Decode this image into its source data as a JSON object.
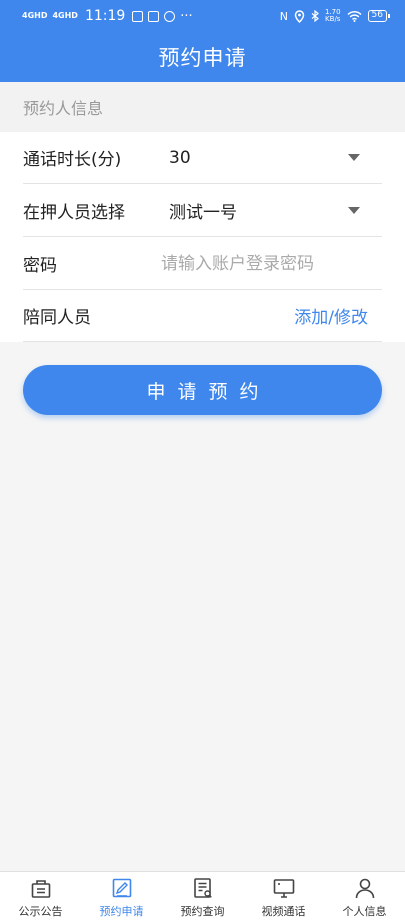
{
  "status_bar": {
    "network1": "4GHD",
    "network2": "4GHD",
    "time": "11:19",
    "more": "···",
    "nfc": "N",
    "speed_value": "1.70",
    "speed_unit": "KB/s",
    "battery": "56"
  },
  "header": {
    "title": "预约申请"
  },
  "section": {
    "title": "预约人信息"
  },
  "form": {
    "duration": {
      "label": "通话时长(分)",
      "value": "30"
    },
    "detainee": {
      "label": "在押人员选择",
      "value": "测试一号"
    },
    "password": {
      "label": "密码",
      "placeholder": "请输入账户登录密码"
    },
    "companion": {
      "label": "陪同人员",
      "link": "添加/修改"
    }
  },
  "submit_label": "申请预约",
  "tabs": [
    {
      "label": "公示公告",
      "icon": "announcement-icon",
      "active": false
    },
    {
      "label": "预约申请",
      "icon": "edit-icon",
      "active": true
    },
    {
      "label": "预约查询",
      "icon": "document-search-icon",
      "active": false
    },
    {
      "label": "视频通话",
      "icon": "monitor-icon",
      "active": false
    },
    {
      "label": "个人信息",
      "icon": "person-icon",
      "active": false
    }
  ],
  "colors": {
    "primary": "#3f87ec",
    "background": "#f5f5f5",
    "muted": "#999999"
  }
}
